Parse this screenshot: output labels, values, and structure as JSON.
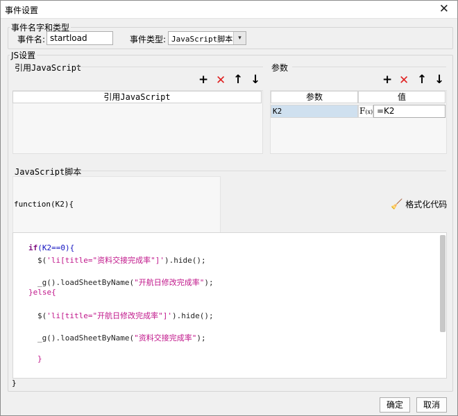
{
  "window": {
    "title": "事件设置"
  },
  "event_group": {
    "legend": "事件名字和类型",
    "name_label": "事件名:",
    "name_value": "startload",
    "type_label": "事件类型:",
    "type_value": "JavaScript脚本"
  },
  "js_group": {
    "legend": "JS设置"
  },
  "ref_js": {
    "section_title": "引用JavaScript",
    "column_header": "引用JavaScript"
  },
  "params": {
    "section_title": "参数",
    "col_param": "参数",
    "col_value": "值",
    "rows": [
      {
        "param": "K2",
        "value": "=K2"
      }
    ]
  },
  "toolbar": {
    "add": "+",
    "remove": "✕",
    "up": "🡑",
    "down": "🡓"
  },
  "script": {
    "section_title": "JavaScript脚本",
    "header_code": "function(K2){",
    "format_label": "格式化代码",
    "closing_brace": "}"
  },
  "code": {
    "l1_kw": "if",
    "l1_rest": "(K2==0){",
    "l2_a": "$(",
    "l2_str": "'li[title=\"资料交接完成率\"]'",
    "l2_b": ").hide();",
    "l3_a": "_g().loadSheetByName(",
    "l3_str": "\"开航日修改完成率\"",
    "l3_b": ");",
    "l4": "}else{",
    "l5_a": "$(",
    "l5_str": "'li[title=\"开航日修改完成率\"]'",
    "l5_b": ").hide();",
    "l6_a": "_g().loadSheetByName(",
    "l6_str": "\"资料交接完成率\"",
    "l6_b": ");",
    "l7": "}"
  },
  "footer": {
    "ok": "确定",
    "cancel": "取消"
  }
}
